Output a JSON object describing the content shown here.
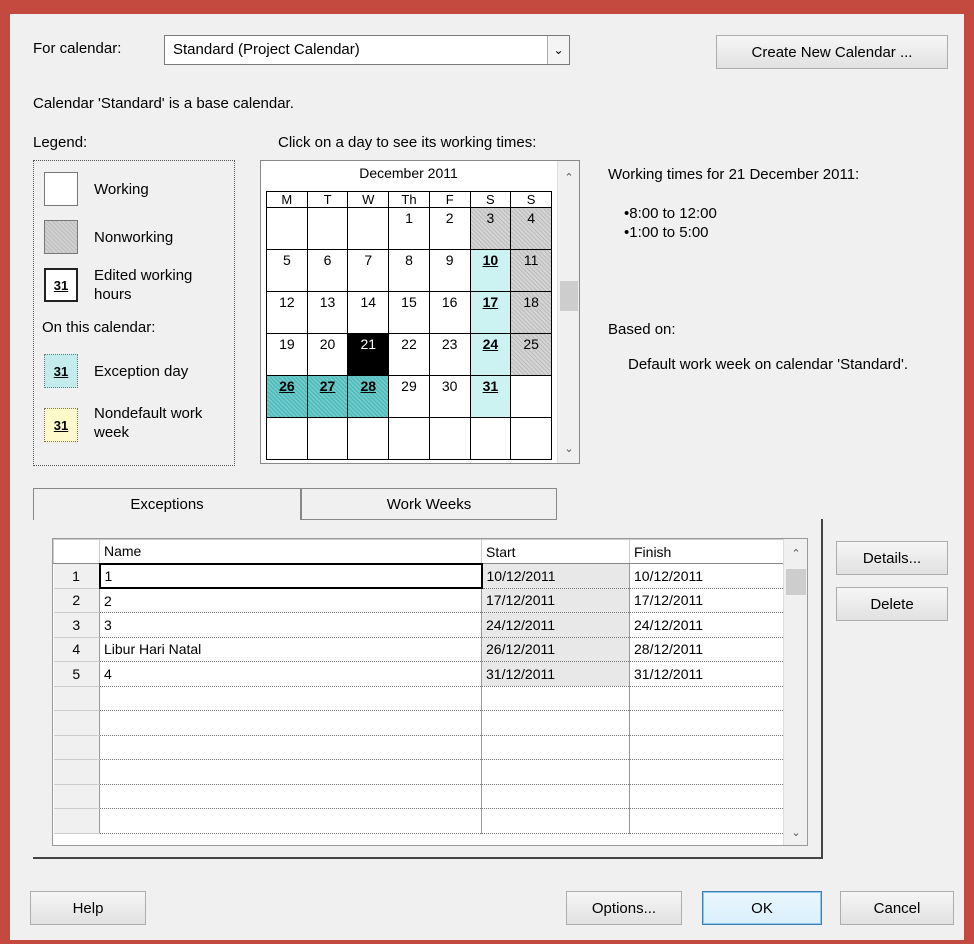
{
  "for_calendar_label": "For calendar:",
  "calendar_selected": "Standard (Project Calendar)",
  "create_new_calendar": "Create New Calendar ...",
  "base_calendar_note": "Calendar 'Standard' is a base calendar.",
  "legend": {
    "title": "Legend:",
    "working": "Working",
    "nonworking": "Nonworking",
    "edited": "Edited working hours",
    "on_this_calendar": "On this calendar:",
    "exception": "Exception day",
    "nondefault": "Nondefault work week",
    "swatch_number": "31"
  },
  "click_hint": "Click on a day to see its working times:",
  "calendar": {
    "month": "December 2011",
    "days": [
      "M",
      "T",
      "W",
      "Th",
      "F",
      "S",
      "S"
    ],
    "weeks": [
      [
        "",
        "",
        "",
        "1",
        "2",
        "3",
        "4"
      ],
      [
        "5",
        "6",
        "7",
        "8",
        "9",
        "10",
        "11"
      ],
      [
        "12",
        "13",
        "14",
        "15",
        "16",
        "17",
        "18"
      ],
      [
        "19",
        "20",
        "21",
        "22",
        "23",
        "24",
        "25"
      ],
      [
        "26",
        "27",
        "28",
        "29",
        "30",
        "31",
        ""
      ],
      [
        "",
        "",
        "",
        "",
        "",
        "",
        ""
      ]
    ]
  },
  "working_times": {
    "title": "Working times for 21 December 2011:",
    "slots": [
      "8:00 to 12:00",
      "1:00 to 5:00"
    ],
    "based_on_label": "Based on:",
    "based_on_text": "Default work week on calendar 'Standard'."
  },
  "tabs": {
    "exceptions": "Exceptions",
    "work_weeks": "Work Weeks"
  },
  "exceptions_table": {
    "headers": [
      "Name",
      "Start",
      "Finish"
    ],
    "rows": [
      [
        "1",
        "1",
        "10/12/2011",
        "10/12/2011"
      ],
      [
        "2",
        "2",
        "17/12/2011",
        "17/12/2011"
      ],
      [
        "3",
        "3",
        "24/12/2011",
        "24/12/2011"
      ],
      [
        "4",
        "Libur Hari Natal",
        "26/12/2011",
        "28/12/2011"
      ],
      [
        "5",
        "4",
        "31/12/2011",
        "31/12/2011"
      ],
      [
        "",
        "",
        "",
        ""
      ],
      [
        "",
        "",
        "",
        ""
      ],
      [
        "",
        "",
        "",
        ""
      ],
      [
        "",
        "",
        "",
        ""
      ],
      [
        "",
        "",
        "",
        ""
      ],
      [
        "",
        "",
        "",
        ""
      ]
    ]
  },
  "side_buttons": {
    "details": "Details...",
    "delete": "Delete"
  },
  "footer": {
    "help": "Help",
    "options": "Options...",
    "ok": "OK",
    "cancel": "Cancel"
  }
}
